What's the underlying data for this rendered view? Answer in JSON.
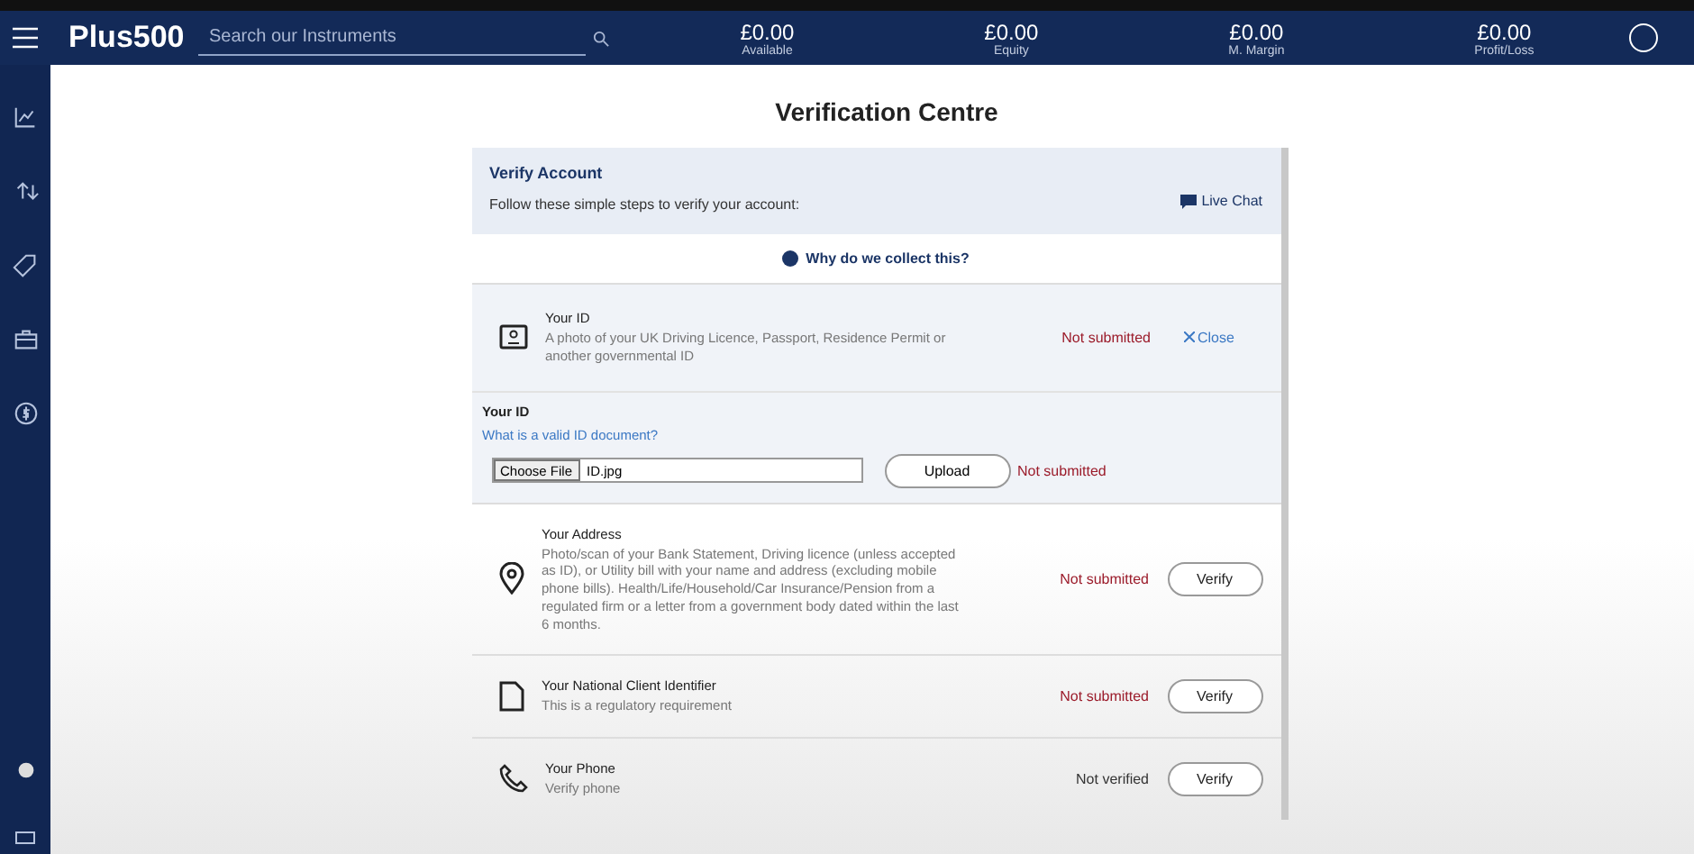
{
  "header": {
    "logo": "Plus500",
    "search": {
      "placeholder": "Search our Instruments"
    },
    "stats": [
      {
        "value": "£0.00",
        "label": "Available"
      },
      {
        "value": "£0.00",
        "label": "Equity"
      },
      {
        "value": "£0.00",
        "label": "M. Margin"
      },
      {
        "value": "£0.00",
        "label": "Profit/Loss"
      }
    ]
  },
  "page": {
    "title": "Verification Centre",
    "intro": {
      "title": "Verify Account",
      "text": "Follow these simple steps to verify your account:",
      "live_chat": "Live Chat"
    },
    "why_link": "Why do we collect this?",
    "items": [
      {
        "kind": "expanded",
        "title": "Your ID",
        "description": "A photo of your UK Driving Licence, Passport, Residence Permit or another governmental ID",
        "status": "Not submitted",
        "color": "#9b1b2a",
        "action": "Close",
        "form": {
          "heading": "Your ID",
          "link": "What is a valid ID document?",
          "choose_file": "Choose File",
          "file_name": "ID.jpg",
          "upload": "Upload",
          "status": "Not submitted"
        }
      },
      {
        "kind": "collapsed",
        "title": "Your Address",
        "description": "Photo/scan of your Bank Statement, Driving licence (unless accepted as ID), or Utility bill with your name and address (excluding mobile phone bills). Health/Life/Household/Car Insurance/Pension from a regulated firm or a letter from a government body dated within the last 6 months.",
        "status": "Not submitted",
        "color": "#9b1b2a",
        "action": "Verify"
      },
      {
        "kind": "collapsed",
        "title": "Your National Client Identifier",
        "description": "This is a regulatory requirement",
        "status": "Not submitted",
        "color": "#9b1b2a",
        "action": "Verify"
      },
      {
        "kind": "collapsed",
        "title": "Your Phone",
        "description": "Verify phone",
        "status": "Not verified",
        "color": "#333333",
        "action": "Verify"
      }
    ]
  }
}
